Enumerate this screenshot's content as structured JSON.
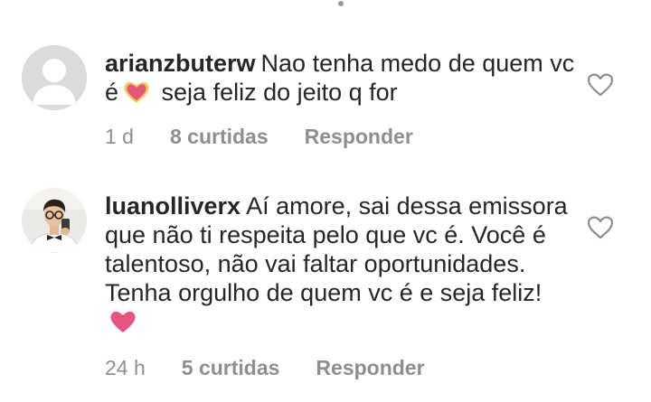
{
  "comments": [
    {
      "username": "arianzbuterw",
      "text_before": "Nao tenha medo de quem vc é",
      "emoji": "sparkling-heart-icon",
      "text_after": " seja feliz do jeito q for",
      "time": "1 d",
      "likes": "8 curtidas",
      "reply_label": "Responder",
      "avatar": "default-avatar-icon"
    },
    {
      "username": "luanolliverx",
      "text_before": "Aí amore, sai dessa emissora que não ti respeita pelo que vc é. Você é talentoso, não vai faltar oportunidades. Tenha orgulho de quem vc é e seja feliz!",
      "emoji": "pink-heart-icon",
      "text_after": "",
      "time": "24 h",
      "likes": "5 curtidas",
      "reply_label": "Responder",
      "avatar": "user-photo-avatar"
    }
  ],
  "colors": {
    "text": "#262626",
    "meta": "#8e8e8e",
    "heart_pink": "#e75480",
    "avatar_bg": "#dbdbdb"
  }
}
